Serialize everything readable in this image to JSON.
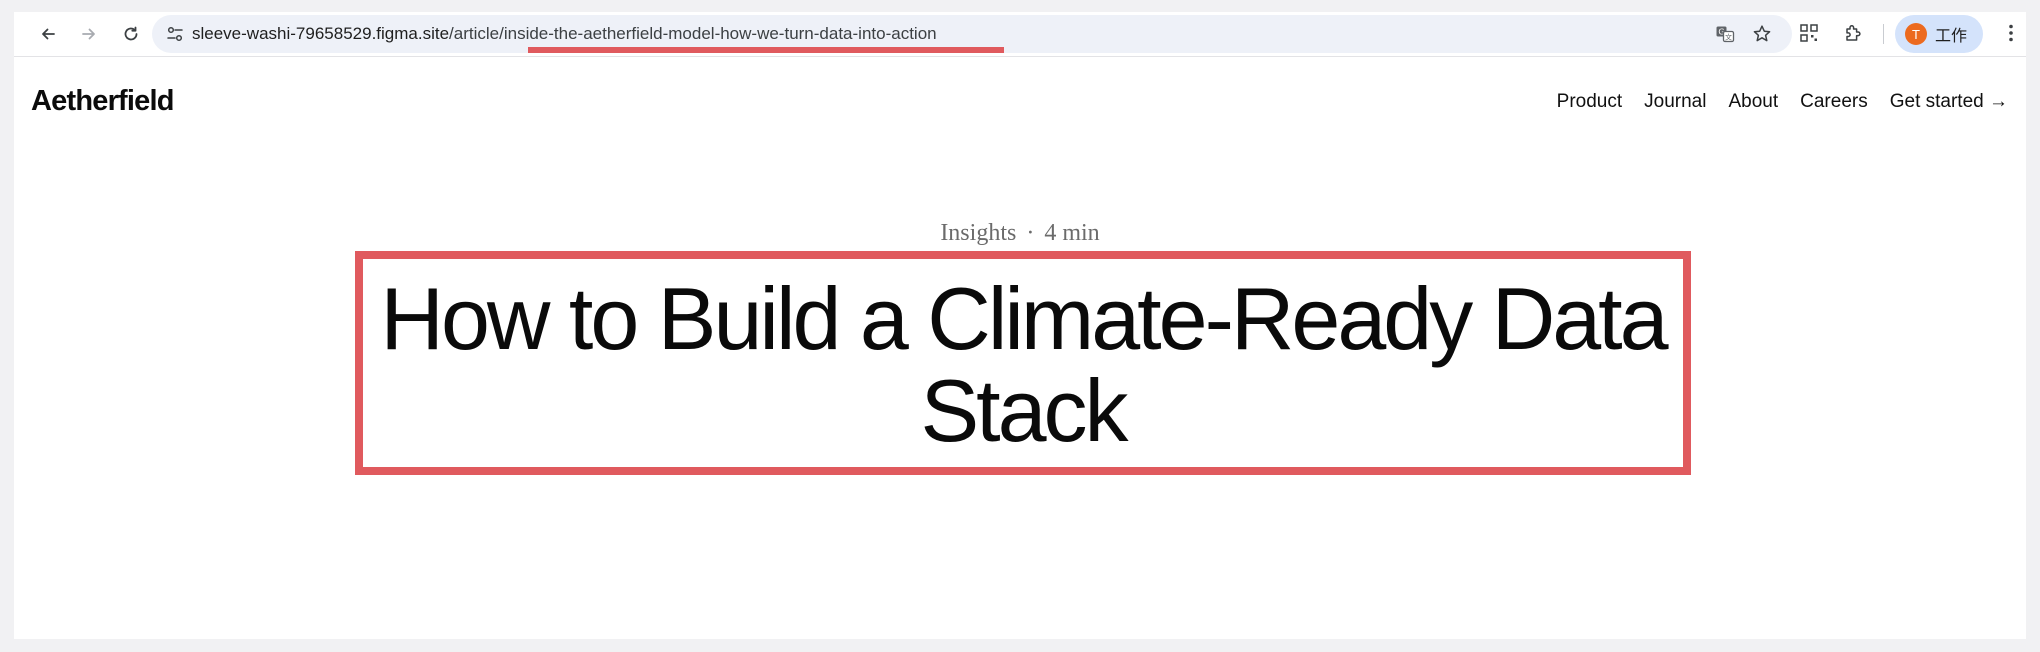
{
  "browser": {
    "url_host": "sleeve-washi-79658529.figma.site",
    "url_path": "/article/inside-the-aetherfield-model-how-we-turn-data-into-action",
    "profile_initial": "T",
    "profile_name": "工作",
    "icons": [
      "back-icon",
      "forward-icon",
      "reload-icon",
      "site-info-icon",
      "translate-icon",
      "bookmark-star-icon",
      "qr-code-icon",
      "extensions-icon",
      "menu-dots-icon"
    ]
  },
  "site": {
    "logo": "Aetherfield",
    "nav": [
      {
        "label": "Product"
      },
      {
        "label": "Journal"
      },
      {
        "label": "About"
      },
      {
        "label": "Careers"
      },
      {
        "label": "Get started →"
      }
    ]
  },
  "article": {
    "category": "Insights",
    "separator": "·",
    "read_time": "4 min",
    "title": "How to Build a Climate-Ready Data Stack"
  },
  "colors": {
    "highlight": "#e05a5e",
    "omnibox_bg": "#eef1f8",
    "profile_chip_bg": "#d4e3fb",
    "avatar_bg": "#ec6a1f"
  }
}
